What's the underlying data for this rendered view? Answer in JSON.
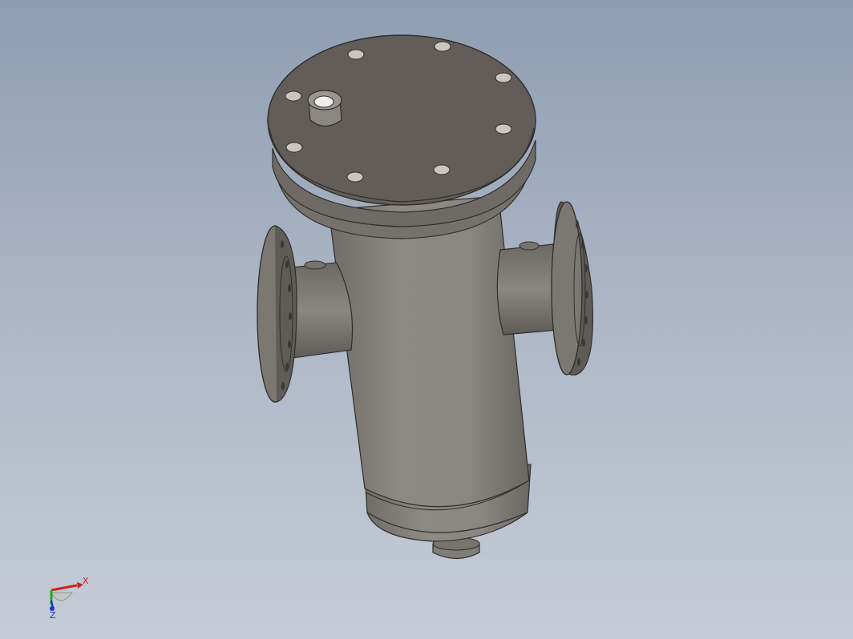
{
  "viewport": {
    "background_top": "#8e9db2",
    "background_bottom": "#c6ccd6"
  },
  "model": {
    "part": "basket-strainer",
    "body_color": "#8a8780",
    "cap_color": "#625d58",
    "edge_color": "#2f2d2a",
    "bolt_hole_count_cover": 8
  },
  "triad": {
    "x_label": "X",
    "z_label": "Z",
    "x_color": "#cc2222",
    "y_color": "#22aa22",
    "z_color": "#2233cc"
  }
}
